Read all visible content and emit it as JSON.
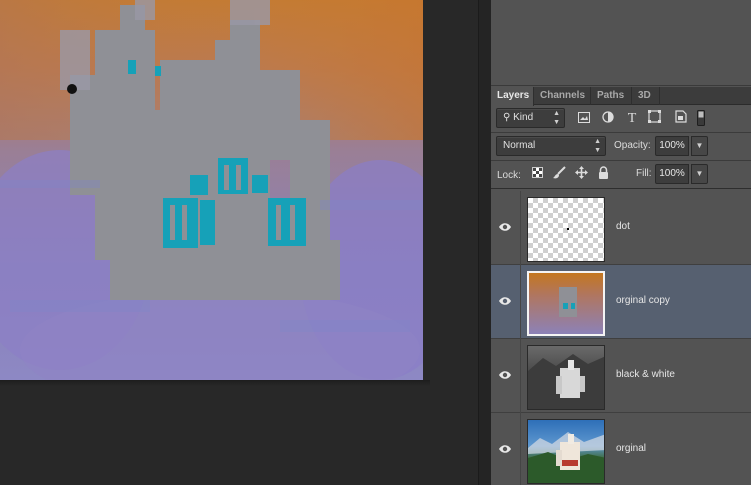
{
  "canvas": {
    "document_area_color": "#282828"
  },
  "panel": {
    "tabs": [
      {
        "label": "Layers",
        "active": true
      },
      {
        "label": "Channels",
        "active": false
      },
      {
        "label": "Paths",
        "active": false
      },
      {
        "label": "3D",
        "active": false
      }
    ],
    "filter": {
      "kind_label": "Kind",
      "filter_icons": [
        "image-filter-icon",
        "adjustment-filter-icon",
        "type-filter-icon",
        "shape-filter-icon",
        "smart-object-filter-icon",
        "filter-toggle-icon"
      ]
    },
    "blend_mode": "Normal",
    "opacity_label": "Opacity:",
    "opacity_value": "100%",
    "lock_label": "Lock:",
    "lock_icons": [
      "lock-transparency-icon",
      "lock-pixels-icon",
      "lock-position-icon",
      "lock-all-icon"
    ],
    "fill_label": "Fill:",
    "fill_value": "100%"
  },
  "layers": [
    {
      "name": "dot",
      "visible": true,
      "selected": false,
      "thumbnail": "transparent-checker"
    },
    {
      "name": "orginal copy",
      "visible": true,
      "selected": true,
      "thumbnail": "inverted-castle"
    },
    {
      "name": "black & white",
      "visible": true,
      "selected": false,
      "thumbnail": "grayscale-castle"
    },
    {
      "name": "orginal",
      "visible": true,
      "selected": false,
      "thumbnail": "color-castle"
    }
  ],
  "colors": {
    "panel_bg": "#535353",
    "selected_layer_bg": "#566070",
    "tabbar_bg": "#3c3c3c"
  }
}
